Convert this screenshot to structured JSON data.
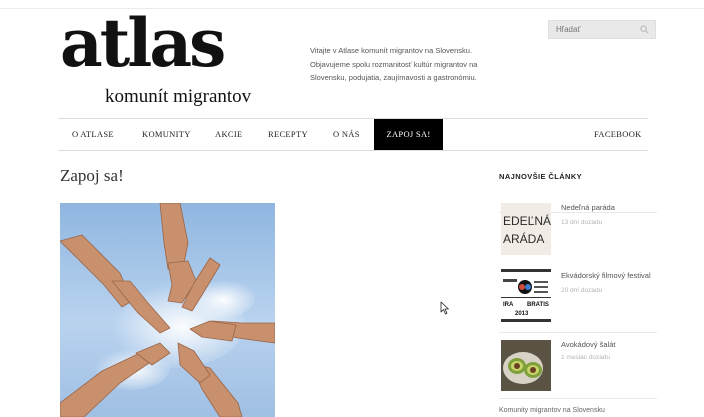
{
  "logo": {
    "main": "atlas",
    "sub": "komunít migrantov"
  },
  "intro": {
    "text": "Vitajte v Atlase komunít migrantov na Slovensku. Objavujeme spolu rozmanitosť kultúr migrantov na Slovensku, podujatia, zaujímavosti a gastronómiu."
  },
  "search": {
    "placeholder": "Hľadať",
    "icon": "search-icon"
  },
  "nav": {
    "items": [
      "O ATLASE",
      "KOMUNITY",
      "AKCIE",
      "RECEPTY",
      "O NÁS",
      "ZAPOJ SA!"
    ],
    "active_index": 5,
    "facebook": "FACEBOOK"
  },
  "page": {
    "title": "Zapoj sa!"
  },
  "sidebar": {
    "title": "NAJNOVŠIE ČLÁNKY",
    "articles": [
      {
        "title": "Nedeľná paráda",
        "date": "13 dní dozadu",
        "thumb_text": [
          "EDEĽNÁ",
          "ARÁDA"
        ]
      },
      {
        "title": "Ekvádorský filmový festival",
        "date": "20 dní dozadu",
        "thumb_text": [
          "IRA",
          "BRATIS",
          "2013"
        ]
      },
      {
        "title": "Avokádový šalát",
        "date": "1 mesiac dozadu"
      }
    ],
    "footer": "Komunity migrantov na Slovensku"
  },
  "colors": {
    "nav_active_bg": "#000000",
    "search_bg": "#e9e9e9",
    "text": "#222222"
  }
}
